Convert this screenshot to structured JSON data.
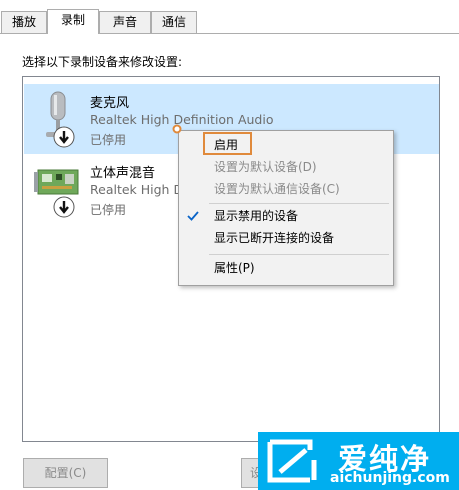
{
  "tabs": [
    {
      "label": "播放"
    },
    {
      "label": "录制"
    },
    {
      "label": "声音"
    },
    {
      "label": "通信"
    }
  ],
  "active_tab": "录制",
  "instruction": "选择以下录制设备来修改设置:",
  "devices": [
    {
      "name": "麦克风",
      "driver": "Realtek High Definition Audio",
      "status": "已停用",
      "icon": "microphone-icon",
      "selected": true
    },
    {
      "name": "立体声混音",
      "driver": "Realtek High De",
      "status": "已停用",
      "icon": "sound-card-icon",
      "selected": false
    }
  ],
  "context_menu": {
    "items": [
      {
        "label": "启用",
        "enabled": true
      },
      {
        "label": "设置为默认设备(D)",
        "enabled": false
      },
      {
        "label": "设置为默认通信设备(C)",
        "enabled": false
      },
      {
        "label": "显示禁用的设备",
        "enabled": true,
        "checked": true
      },
      {
        "label": "显示已断开连接的设备",
        "enabled": true
      },
      {
        "label": "属性(P)",
        "enabled": true
      }
    ]
  },
  "buttons": {
    "configure": "配置(C)",
    "set_default_partial": "设"
  },
  "watermark": {
    "brand_text": "爱纯净",
    "url": "aichunjing.com"
  },
  "colors": {
    "selection": "#cce8ff",
    "highlight_box": "#e08a3c",
    "watermark_bg": "#00aeef",
    "check": "#0a64c8"
  }
}
